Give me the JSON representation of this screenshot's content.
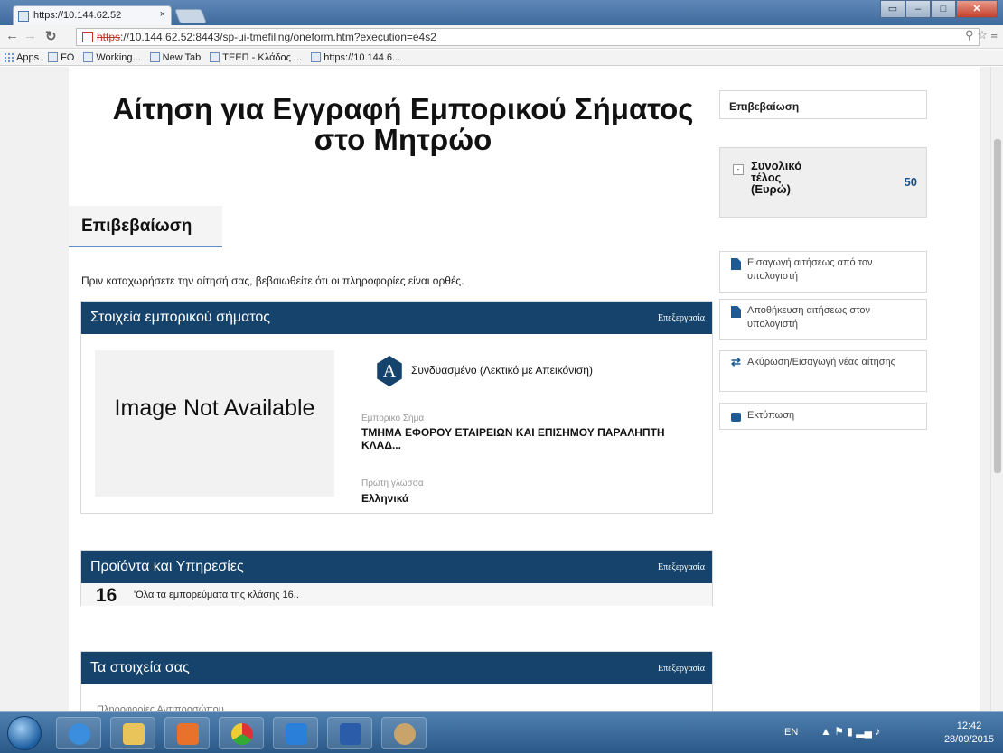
{
  "browser": {
    "tab_title": "https://10.144.62.52",
    "tab_close": "×",
    "url_scheme": "https",
    "url_rest": "://10.144.62.52:8443/sp-ui-tmefiling/oneform.htm?execution=e4s2",
    "bookmarks": [
      "Apps",
      "FO",
      "Working...",
      "New Tab",
      "ΤΕΕΠ - Κλάδος ...",
      "https://10.144.6..."
    ]
  },
  "page": {
    "title": "Αίτηση για Εγγραφή Εμπορικού Σήματος στο Μητρώο",
    "section_tab": "Επιβεβαίωση",
    "intro": "Πριν καταχωρήσετε την αίτησή σας, βεβαιωθείτε ότι οι πληροφορίες είναι ορθές."
  },
  "trademark_panel": {
    "title": "Στοιχεία εμπορικού σήματος",
    "edit_label": "Επεξεργασία",
    "image_placeholder": "Image Not Available",
    "type_badge": "A",
    "type_text": "Συνδυασμένο (Λεκτικό με Απεικόνιση)",
    "mark_label": "Εμπορικό Σήμα",
    "mark_value": "ΤΜΗΜΑ ΕΦΟΡΟΥ ΕΤΑΙΡΕΙΩΝ ΚΑΙ ΕΠΙΣΗΜΟΥ ΠΑΡΑΛΗΠΤΗ ΚΛΑΔ...",
    "lang_label": "Πρώτη γλώσσα",
    "lang_value": "Ελληνικά"
  },
  "goods_panel": {
    "title": "Προϊόντα και Υπηρεσίες",
    "edit_label": "Επεξεργασία",
    "class_number": "16",
    "class_text": "'Ολα τα εμπορεύματα της κλάσης 16.."
  },
  "details_panel": {
    "title": "Τα στοιχεία σας",
    "edit_label": "Επεξεργασία",
    "subheading": "Πληροφορίες Αντιπροσώπου"
  },
  "sidebar": {
    "confirm": "Επιβεβαίωση",
    "fee_toggle": "-",
    "fee_label": "Συνολικό τέλος (Ευρώ)",
    "fee_value": "50",
    "actions": [
      "Εισαγωγή αιτήσεως από τον υπολογιστή",
      "Αποθήκευση αιτήσεως στον υπολογιστή",
      "Ακύρωση/Εισαγωγή νέας αίτησης",
      "Εκτύπωση"
    ]
  },
  "taskbar": {
    "lang": "EN",
    "time": "12:42",
    "date": "28/09/2015"
  }
}
